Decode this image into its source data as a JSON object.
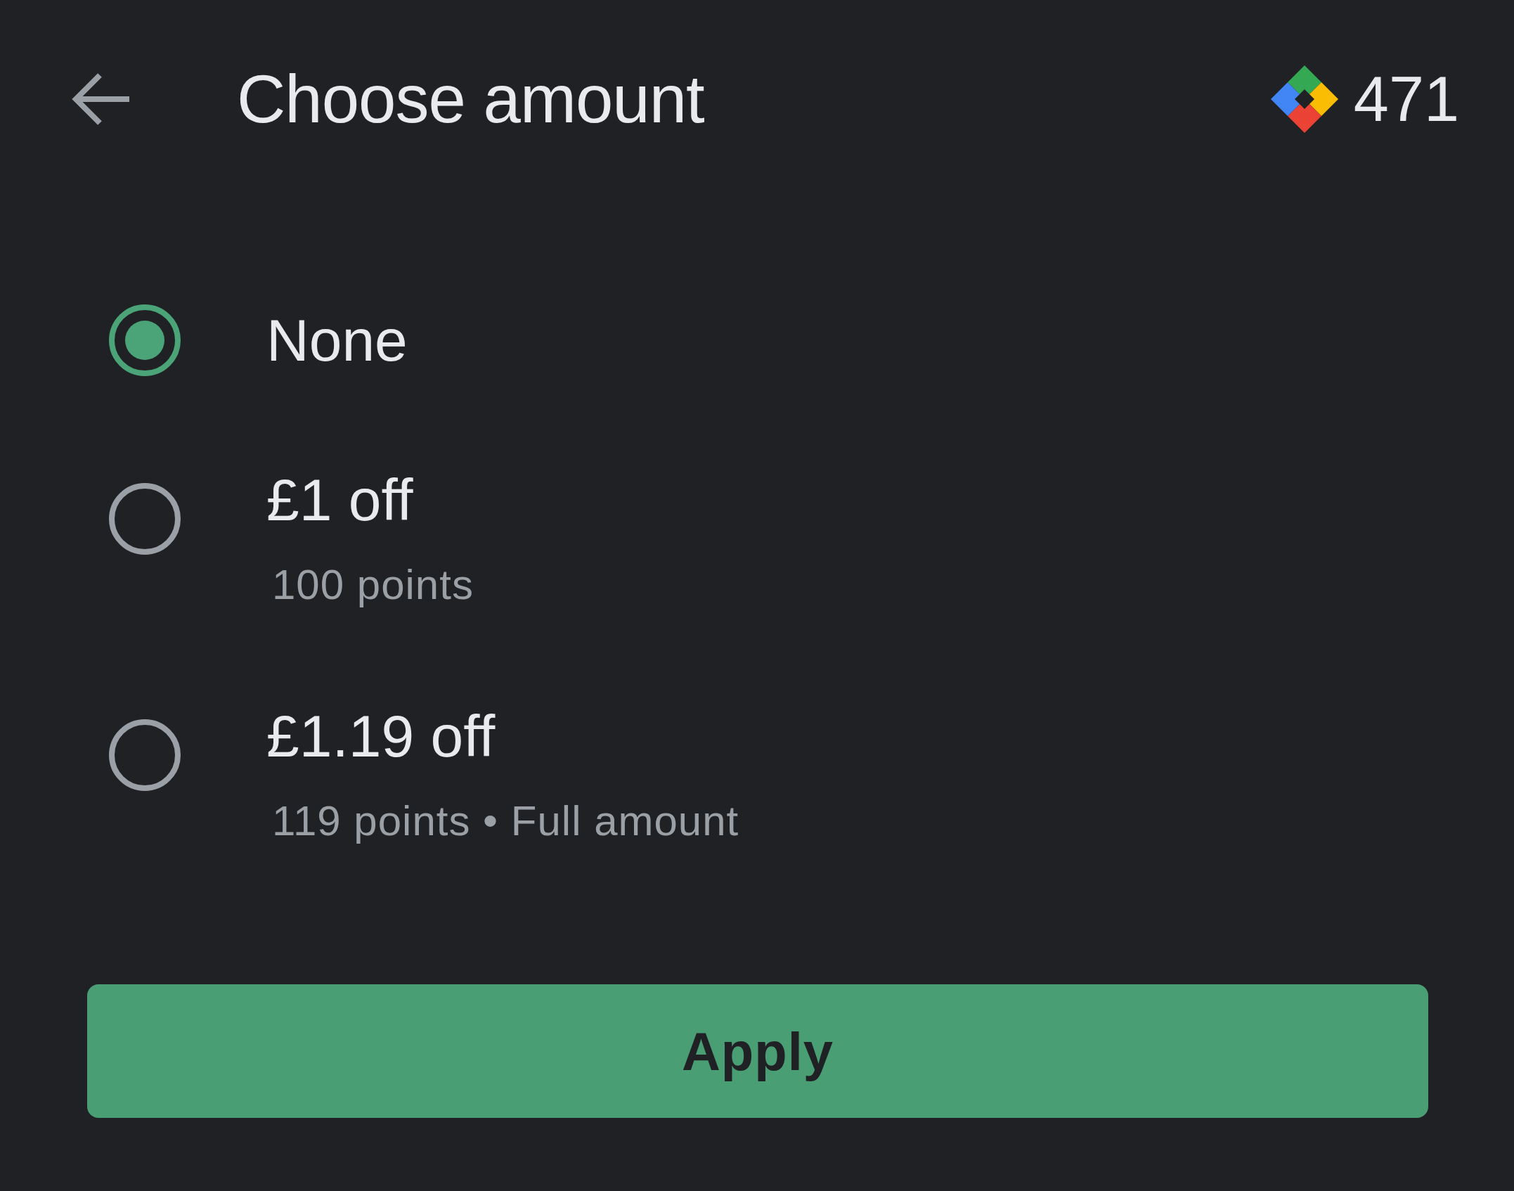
{
  "header": {
    "title": "Choose amount",
    "points": "471"
  },
  "options": [
    {
      "label": "None",
      "selected": true
    },
    {
      "label": "£1 off",
      "detail": "100 points",
      "selected": false
    },
    {
      "label": "£1.19 off",
      "detail": "119 points • Full amount",
      "selected": false
    }
  ],
  "apply_button": {
    "label": "Apply"
  }
}
